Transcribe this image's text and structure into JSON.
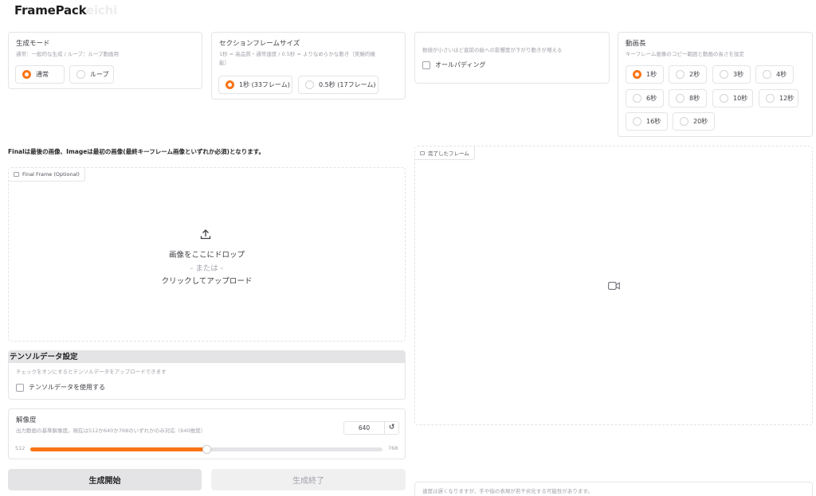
{
  "app": {
    "title": "FramePack",
    "title_suffix": "eichi"
  },
  "generation_mode": {
    "label": "生成モード",
    "info": "通常：一般的な生成 / ループ：ループ動画用",
    "options": [
      "通常",
      "ループ"
    ],
    "selected": "通常"
  },
  "section_frame_size": {
    "label": "セクションフレームサイズ",
    "info_line1": "1秒 = 高品質・通常速度 / 0.5秒 = よりなめらかな動き（実験的機",
    "info_line2": "能）",
    "options": [
      "1秒 (33フレーム)",
      "0.5秒 (17フレーム)"
    ],
    "selected": "1秒 (33フレーム)"
  },
  "padding": {
    "info": "数値が小さいほど直前の絵への影響度が下がり動きが増える",
    "checkbox_label": "オールパディング",
    "checked": false
  },
  "video_length": {
    "label": "動画長",
    "info": "キーフレーム画像のコピー範囲と動画の長さを設定",
    "options": [
      "1秒",
      "2秒",
      "3秒",
      "4秒",
      "6秒",
      "8秒",
      "10秒",
      "12秒",
      "16秒",
      "20秒"
    ],
    "selected": "1秒"
  },
  "final_note": "Finalは最後の画像、Imageは最初の画像(最終キーフレーム画像といずれか必須)となります。",
  "final_frame": {
    "label": "Final Frame (Optional)",
    "drop_text": "画像をここにドロップ",
    "or_text": "- または -",
    "click_text": "クリックしてアップロード"
  },
  "completed_frame": {
    "label": "完了したフレーム"
  },
  "tensor": {
    "header": "テンソルデータ設定",
    "info": "チェックをオンにするとテンソルデータをアップロードできます",
    "checkbox_label": "テンソルデータを使用する",
    "checked": false
  },
  "resolution": {
    "label": "解像度",
    "info": "出力動画の基準解像度。現在は512か640か768のいずれかのみ対応（640推奨）",
    "value": "640",
    "min": "512",
    "max": "768",
    "fraction": 0.5,
    "reset_icon": "↺"
  },
  "buttons": {
    "start": "生成開始",
    "stop": "生成終了"
  },
  "bottom_note": "速度は遅くなりますが、手や指の表現が若干劣化する可能性があります。",
  "colors": {
    "accent": "#f97316",
    "secondary_button": "#e4e4e7",
    "disabled_text": "#a1a1aa"
  }
}
